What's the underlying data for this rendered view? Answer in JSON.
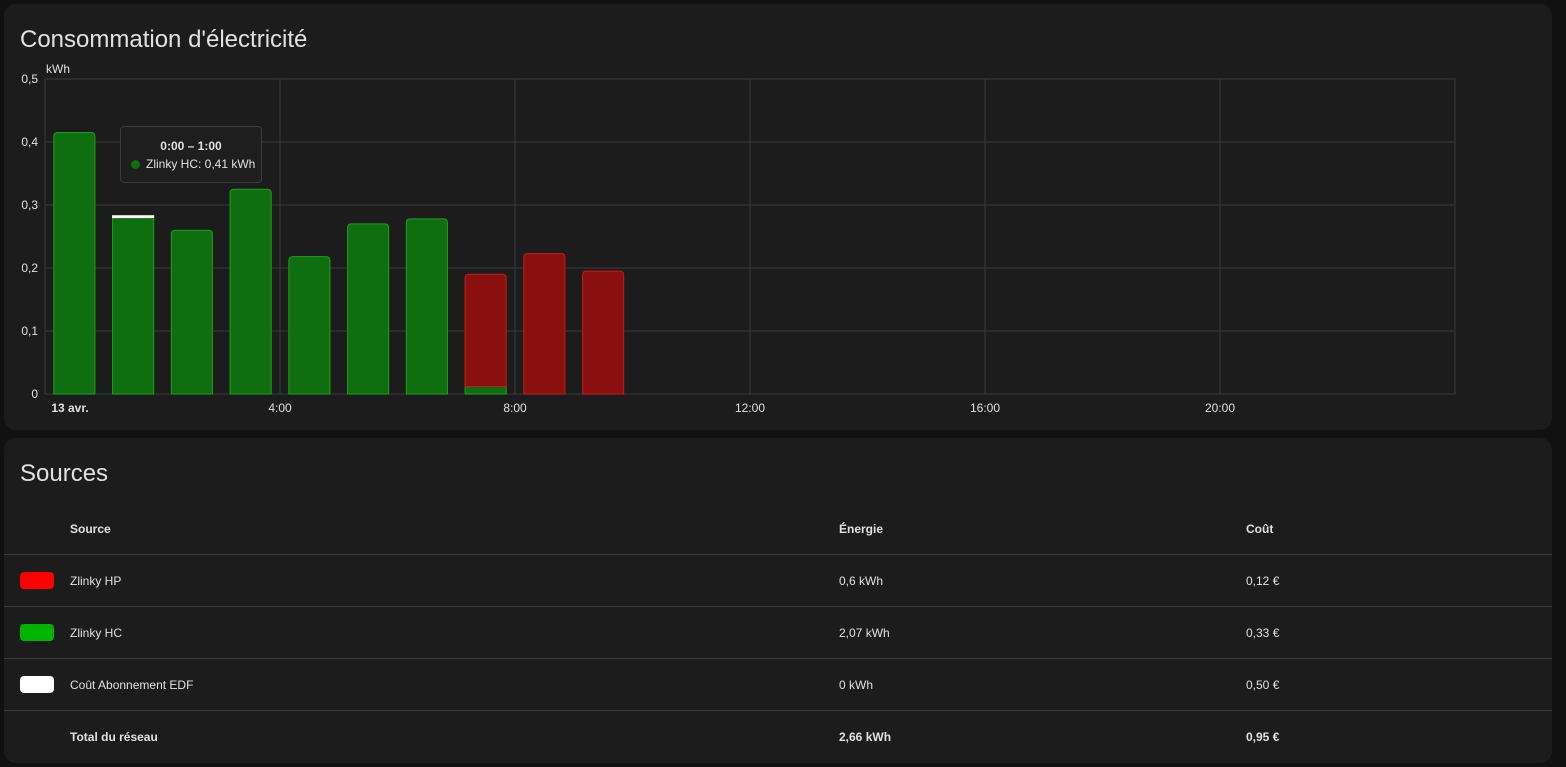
{
  "chart_card": {
    "title": "Consommation d'électricité",
    "tooltip": {
      "title": "0:00 – 1:00",
      "line": "Zlinky HC: 0,41 kWh",
      "color": "#0f6e0f"
    }
  },
  "chart_data": {
    "type": "bar",
    "stacked": true,
    "ylabel": "kWh",
    "ylim": [
      0,
      0.5
    ],
    "y_ticks": [
      "0",
      "0,1",
      "0,2",
      "0,3",
      "0,4",
      "0,5"
    ],
    "x_range_hours": [
      0,
      24
    ],
    "x_ticks": [
      {
        "hour": 0,
        "label": "13 avr."
      },
      {
        "hour": 4,
        "label": "4:00"
      },
      {
        "hour": 8,
        "label": "8:00"
      },
      {
        "hour": 12,
        "label": "12:00"
      },
      {
        "hour": 16,
        "label": "16:00"
      },
      {
        "hour": 20,
        "label": "20:00"
      }
    ],
    "x_hours": [
      0,
      1,
      2,
      3,
      4,
      5,
      6,
      7,
      8,
      9
    ],
    "grid": true,
    "series": [
      {
        "name": "Zlinky HC",
        "fill": "#0f6e0f",
        "stroke": "#1e9e1e",
        "values": [
          0.415,
          0.28,
          0.26,
          0.325,
          0.218,
          0.27,
          0.278,
          0.012,
          0,
          0
        ]
      },
      {
        "name": "Zlinky HP",
        "fill": "#8a1010",
        "stroke": "#c21c1c",
        "values": [
          0,
          0,
          0,
          0,
          0,
          0,
          0,
          0.178,
          0.223,
          0.195
        ]
      },
      {
        "name": "Coût Abonnement EDF",
        "fill": "#ffffff",
        "stroke": "#ffffff",
        "values": [
          0,
          0.003,
          0,
          0,
          0,
          0,
          0,
          0,
          0,
          0
        ]
      }
    ]
  },
  "sources_card": {
    "title": "Sources",
    "headers": {
      "source": "Source",
      "energy": "Énergie",
      "cost": "Coût"
    },
    "rows": [
      {
        "color": "#ff0000",
        "source": "Zlinky HP",
        "energy": "0,6 kWh",
        "cost": "0,12 €"
      },
      {
        "color": "#00b400",
        "source": "Zlinky HC",
        "energy": "2,07 kWh",
        "cost": "0,33 €"
      },
      {
        "color": "#ffffff",
        "source": "Coût Abonnement EDF",
        "energy": "0 kWh",
        "cost": "0,50 €"
      }
    ],
    "total": {
      "source": "Total du réseau",
      "energy": "2,66 kWh",
      "cost": "0,95 €"
    }
  }
}
